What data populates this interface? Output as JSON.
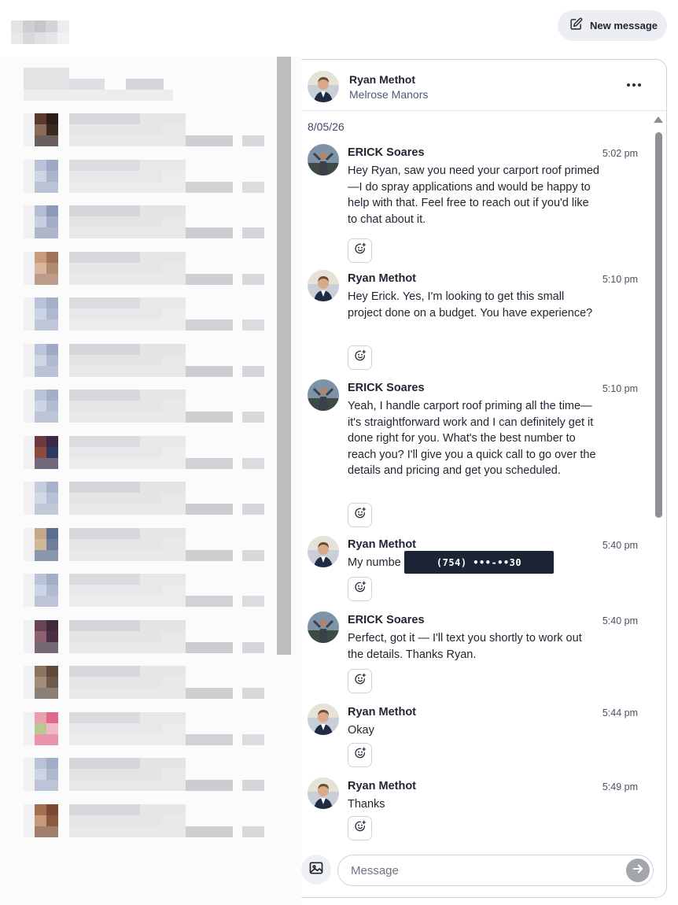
{
  "header": {
    "new_message_label": "New message",
    "new_message_icon": "compose-icon"
  },
  "conversation": {
    "contact_name": "Ryan Methot",
    "contact_subtitle": "Melrose Manors",
    "more_icon": "more-horizontal-icon",
    "date": "8/05/26",
    "messages": [
      {
        "sender": "ERICK Soares",
        "time": "5:02 pm",
        "text": "Hey Ryan, saw you need your carport roof primed—I do spray applications and would be happy to help with that. Feel free to reach out if you'd like to chat about it."
      },
      {
        "sender": "Ryan Methot",
        "time": "5:10 pm",
        "text": "Hey Erick. Yes, I'm looking to get this small project done on a budget. You have experience?"
      },
      {
        "sender": "ERICK Soares",
        "time": "5:10 pm",
        "text": "Yeah, I handle carport roof priming all the time—it's straightforward work and I can definitely get it done right for you. What's the best number to reach you? I'll give you a quick call to go over the details and pricing and get you scheduled."
      },
      {
        "sender": "Ryan Methot",
        "time": "5:40 pm",
        "text": "My numbe                                        xt"
      },
      {
        "sender": "ERICK Soares",
        "time": "5:40 pm",
        "text": "Perfect, got it — I'll text you shortly to work out the details. Thanks Ryan."
      },
      {
        "sender": "Ryan Methot",
        "time": "5:44 pm",
        "text": "Okay"
      },
      {
        "sender": "Ryan Methot",
        "time": "5:49 pm",
        "text": "Thanks"
      }
    ],
    "redacted_phone": "(754) •••-••30",
    "reaction_icon": "add-reaction-icon"
  },
  "composer": {
    "placeholder": "Message",
    "attach_icon": "image-icon",
    "send_icon": "send-arrow-icon"
  },
  "colors": {
    "accent_text": "#4a5b7a",
    "border": "#cfd3de",
    "redact_bg": "#1d2435"
  }
}
